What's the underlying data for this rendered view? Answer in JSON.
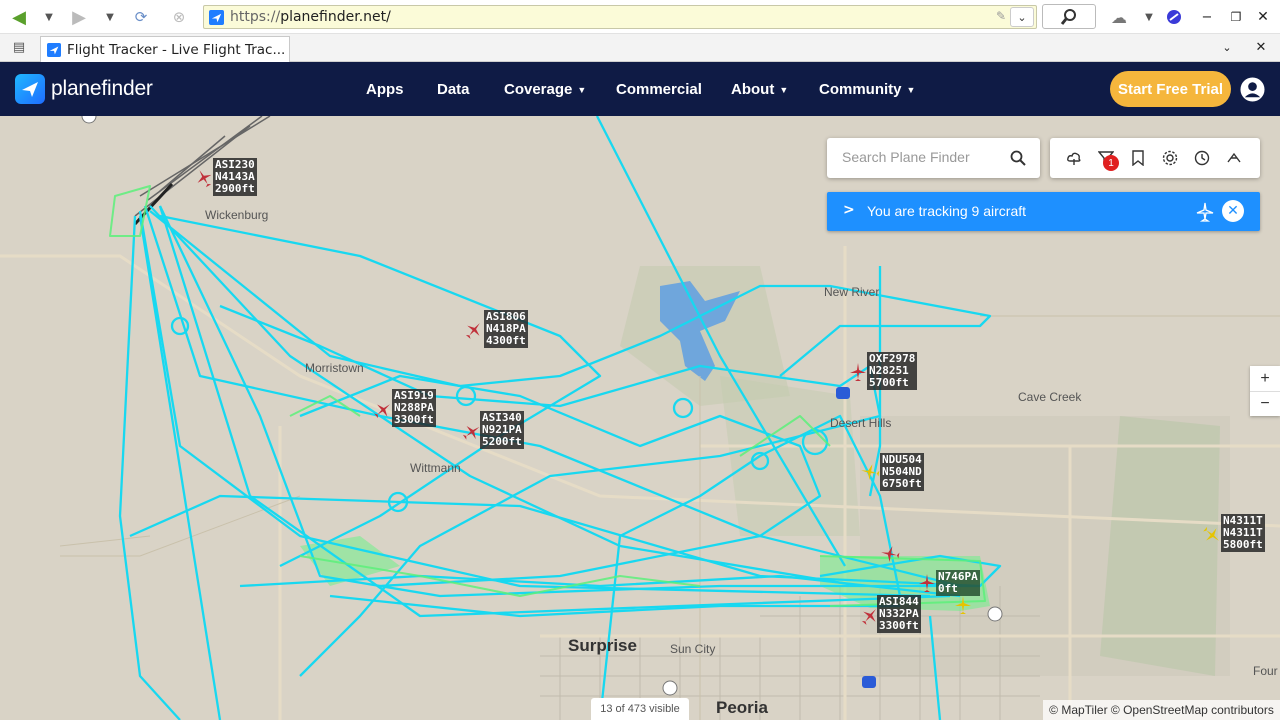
{
  "browser": {
    "url_proto": "https://",
    "url_host": "planefinder.net/",
    "tab_title": "Flight Tracker - Live Flight Trac..."
  },
  "header": {
    "logo_text": "planefinder",
    "nav": [
      {
        "label": "Apps",
        "has_menu": false
      },
      {
        "label": "Data",
        "has_menu": false
      },
      {
        "label": "Coverage",
        "has_menu": true
      },
      {
        "label": "Commercial",
        "has_menu": false
      },
      {
        "label": "About",
        "has_menu": true
      },
      {
        "label": "Community",
        "has_menu": true
      }
    ],
    "trial_label": "Start Free Trial"
  },
  "map": {
    "search_placeholder": "Search Plane Finder",
    "filter_badge": "1",
    "tracking_text": "You are tracking 9 aircraft",
    "visible_count": "13 of 473 visible",
    "attribution": "© MapTiler © OpenStreetMap contributors",
    "zoom_in": "+",
    "zoom_out": "−",
    "places": [
      {
        "name": "Wickenburg",
        "big": false
      },
      {
        "name": "Morristown",
        "big": false
      },
      {
        "name": "Wittmann",
        "big": false
      },
      {
        "name": "New River",
        "big": false
      },
      {
        "name": "Desert Hills",
        "big": false
      },
      {
        "name": "Cave Creek",
        "big": false
      },
      {
        "name": "Surprise",
        "big": true
      },
      {
        "name": "Sun City",
        "big": false
      },
      {
        "name": "Peoria",
        "big": true
      },
      {
        "name": "Four",
        "big": false
      }
    ],
    "aircraft": [
      {
        "line1": "ASI230",
        "line2": "N4143A",
        "line3": "2900ft",
        "color": "#c0303a"
      },
      {
        "line1": "ASI806",
        "line2": "N418PA",
        "line3": "4300ft",
        "color": "#c0303a"
      },
      {
        "line1": "OXF2978",
        "line2": "N28251",
        "line3": "5700ft",
        "color": "#c0303a"
      },
      {
        "line1": "ASI919",
        "line2": "N288PA",
        "line3": "3300ft",
        "color": "#c0303a"
      },
      {
        "line1": "ASI340",
        "line2": "N921PA",
        "line3": "5200ft",
        "color": "#c0303a"
      },
      {
        "line1": "NDU504",
        "line2": "N504ND",
        "line3": "6750ft",
        "color": "#e6c400"
      },
      {
        "line1": "N4311T",
        "line2": "N4311T",
        "line3": "5800ft",
        "color": "#e6c400"
      },
      {
        "line1": "N746PA",
        "line2": "0ft",
        "line3": "",
        "color": "#c0303a"
      },
      {
        "line1": "ASI844",
        "line2": "N332PA",
        "line3": "3300ft",
        "color": "#c0303a"
      }
    ]
  },
  "colors": {
    "header_bg": "#0f1b45",
    "trial_bg": "#f5b63c",
    "track_cyan": "#18d8f0",
    "track_green": "#5cf07a",
    "tracking_bar": "#1e90ff"
  }
}
